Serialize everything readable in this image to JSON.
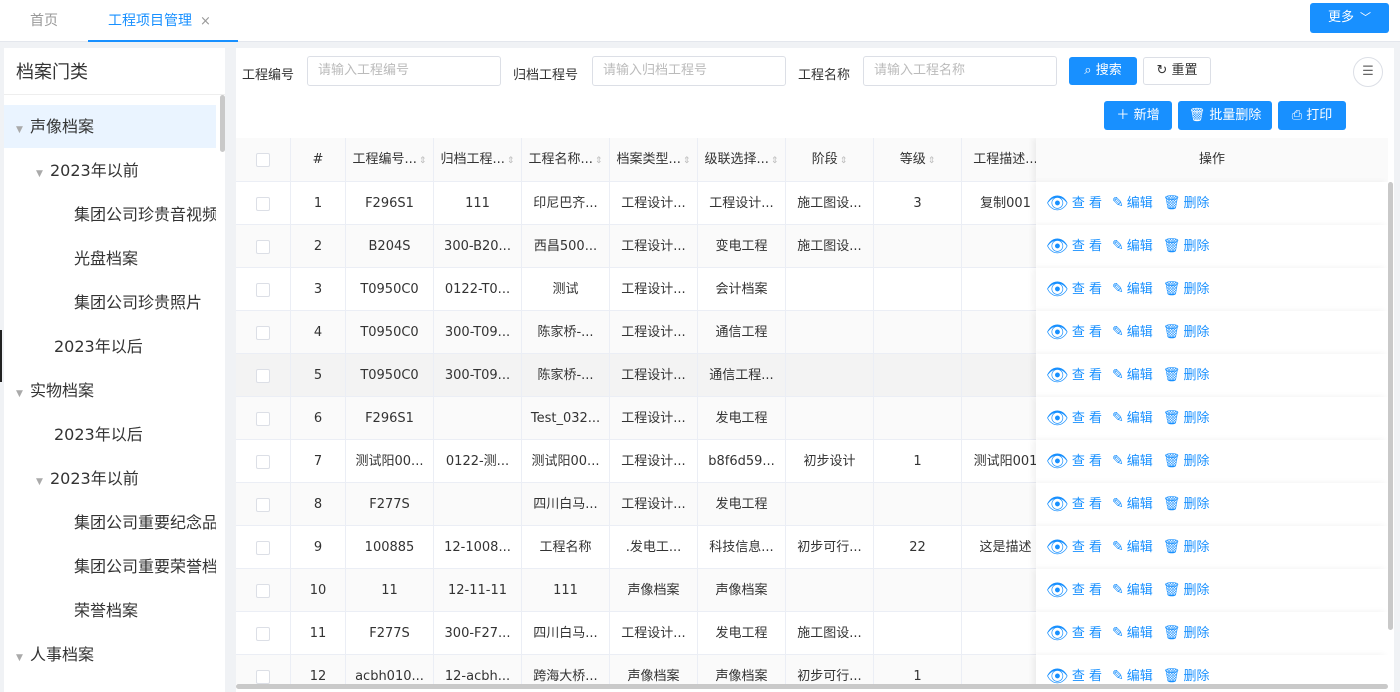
{
  "tabs": {
    "home": "首页",
    "active": "工程项目管理",
    "close": "×",
    "more": "更多"
  },
  "sidebar": {
    "title": "档案门类",
    "nodes": [
      {
        "label": "声像档案",
        "arrow": "▼"
      },
      {
        "label": "2023年以前",
        "arrow": "▼"
      },
      {
        "label": "集团公司珍贵音视频",
        "arrow": ""
      },
      {
        "label": "光盘档案",
        "arrow": ""
      },
      {
        "label": "集团公司珍贵照片",
        "arrow": ""
      },
      {
        "label": "2023年以后",
        "arrow": ""
      },
      {
        "label": "实物档案",
        "arrow": "▼"
      },
      {
        "label": "2023年以后",
        "arrow": ""
      },
      {
        "label": "2023年以前",
        "arrow": "▼"
      },
      {
        "label": "集团公司重要纪念品",
        "arrow": ""
      },
      {
        "label": "集团公司重要荣誉档案",
        "arrow": ""
      },
      {
        "label": "荣誉档案",
        "arrow": ""
      },
      {
        "label": "人事档案",
        "arrow": "▼"
      }
    ]
  },
  "filters": {
    "code_label": "工程编号",
    "code_placeholder": "请输入工程编号",
    "archive_label": "归档工程号",
    "archive_placeholder": "请输入归档工程号",
    "name_label": "工程名称",
    "name_placeholder": "请输入工程名称",
    "search": "搜索",
    "reset": "重置"
  },
  "toolbar": {
    "add": "新增",
    "batch_delete": "批量删除",
    "print": "打印"
  },
  "table": {
    "headers": {
      "index": "#",
      "code": "工程编号...",
      "archive": "归档工程...",
      "name": "工程名称...",
      "type": "档案类型...",
      "cascade": "级联选择...",
      "stage": "阶段",
      "grade": "等级",
      "desc": "工程描述...",
      "ops": "操作"
    },
    "actions": {
      "view": "查 看",
      "edit": "编辑",
      "delete": "删除"
    },
    "rows": [
      {
        "index": "1",
        "code": "F296S1",
        "archive": "111",
        "name": "印尼巴齐...",
        "type": "工程设计...",
        "cascade": "工程设计...",
        "stage": "施工图设...",
        "grade": "3",
        "desc": "复制001"
      },
      {
        "index": "2",
        "code": "B204S",
        "archive": "300-B20...",
        "name": "西昌500...",
        "type": "工程设计...",
        "cascade": "变电工程",
        "stage": "施工图设...",
        "grade": "",
        "desc": ""
      },
      {
        "index": "3",
        "code": "T0950C0",
        "archive": "0122-T0...",
        "name": "测试",
        "type": "工程设计...",
        "cascade": "会计档案",
        "stage": "",
        "grade": "",
        "desc": ""
      },
      {
        "index": "4",
        "code": "T0950C0",
        "archive": "300-T09...",
        "name": "陈家桥-...",
        "type": "工程设计...",
        "cascade": "通信工程",
        "stage": "",
        "grade": "",
        "desc": ""
      },
      {
        "index": "5",
        "code": "T0950C0",
        "archive": "300-T09...",
        "name": "陈家桥-...",
        "type": "工程设计...",
        "cascade": "通信工程...",
        "stage": "",
        "grade": "",
        "desc": ""
      },
      {
        "index": "6",
        "code": "F296S1",
        "archive": "",
        "name": "Test_032...",
        "type": "工程设计...",
        "cascade": "发电工程",
        "stage": "",
        "grade": "",
        "desc": ""
      },
      {
        "index": "7",
        "code": "测试阳00...",
        "archive": "0122-测...",
        "name": "测试阳00...",
        "type": "工程设计...",
        "cascade": "b8f6d59...",
        "stage": "初步设计",
        "grade": "1",
        "desc": "测试阳001"
      },
      {
        "index": "8",
        "code": "F277S",
        "archive": "",
        "name": "四川白马...",
        "type": "工程设计...",
        "cascade": "发电工程",
        "stage": "",
        "grade": "",
        "desc": ""
      },
      {
        "index": "9",
        "code": "100885",
        "archive": "12-1008...",
        "name": "工程名称",
        "type": ".发电工...",
        "cascade": "科技信息...",
        "stage": "初步可行...",
        "grade": "22",
        "desc": "这是描述"
      },
      {
        "index": "10",
        "code": "11",
        "archive": "12-11-11",
        "name": "111",
        "type": "声像档案",
        "cascade": "声像档案",
        "stage": "",
        "grade": "",
        "desc": ""
      },
      {
        "index": "11",
        "code": "F277S",
        "archive": "300-F27...",
        "name": "四川白马...",
        "type": "工程设计...",
        "cascade": "发电工程",
        "stage": "施工图设...",
        "grade": "",
        "desc": ""
      },
      {
        "index": "12",
        "code": "acbh010...",
        "archive": "12-acbh...",
        "name": "跨海大桥...",
        "type": "声像档案",
        "cascade": "声像档案",
        "stage": "初步可行...",
        "grade": "1",
        "desc": ""
      }
    ]
  }
}
